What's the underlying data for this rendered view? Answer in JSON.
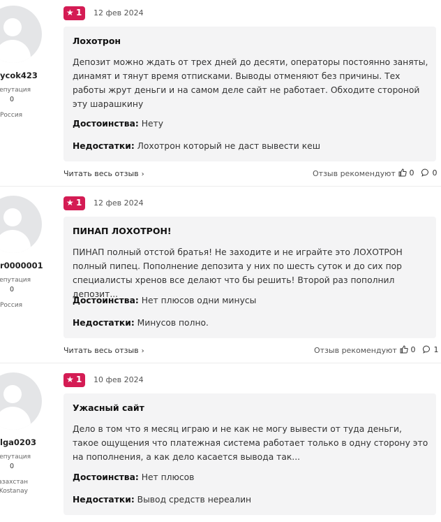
{
  "colors": {
    "badge": "#d41c54",
    "card_bg": "#f4f4f5"
  },
  "icons": {
    "rating": "star-icon",
    "like": "thumbs-up-icon",
    "comment": "comment-icon",
    "more": "chevron-right-icon",
    "avatar": "user-avatar-icon"
  },
  "labels": {
    "reputation": "епутация",
    "pros": "Достоинства:",
    "cons": "Недостатки:",
    "read_more": "Читать весь отзыв",
    "more_chevron": "›",
    "recommend": "Отзыв рекомендуют"
  },
  "reviews": [
    {
      "user": {
        "name": "ycok423",
        "reputation": "0",
        "location": "Россия",
        "location_line2": ""
      },
      "rating": "1",
      "date": "12 фев 2024",
      "title": "Лохотрон",
      "text": "Депозит можно ждать от трех дней до десяти, операторы постоянно заняты, динамят и тянут время отписками. Выводы отменяют без причины. Тех работы жрут деньги и на самом деле сайт не работает. Обходите стороной эту шарашкину",
      "pros": "Нету",
      "cons": "Лохотрон который не даст вывести кеш",
      "likes": "0",
      "comments": "0"
    },
    {
      "user": {
        "name": "r0000001",
        "reputation": "0",
        "location": "Россия",
        "location_line2": ""
      },
      "rating": "1",
      "date": "12 фев 2024",
      "title": "ПИНАП ЛОХОТРОН!",
      "text": "ПИНАП полный отстой братья! Не заходите и не играйте это ЛОХОТРОН полный пипец. Пополнение депозита у них по шесть суток и до сих пор специалисты хренов все делают что бы решить! Второй раз пополнил депозит...",
      "pros": "Нет плюсов одни минусы",
      "cons": "Минусов полно.",
      "likes": "0",
      "comments": "1"
    },
    {
      "user": {
        "name": "lga0203",
        "reputation": "0",
        "location": "азахстан,",
        "location_line2": "Kostanay"
      },
      "rating": "1",
      "date": "10 фев 2024",
      "title": "Ужасный сайт",
      "text": "Дело в том что я месяц играю и не как не могу вывести от туда деньги, такое ощущения что платежная система работает только в одну сторону это на пополнения, а как дело касается вывода так...",
      "pros": "Нет плюсов",
      "cons": "Вывод средств нереалин",
      "likes": "",
      "comments": ""
    }
  ]
}
